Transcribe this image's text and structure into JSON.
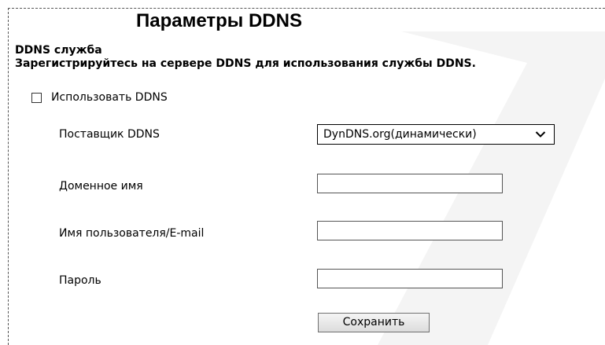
{
  "page": {
    "title": "Параметры DDNS"
  },
  "section": {
    "title": "DDNS служба",
    "description": "Зарегистрируйтесь на сервере DDNS для использования службы DDNS."
  },
  "use_ddns": {
    "label": "Использовать DDNS",
    "checked": false
  },
  "provider": {
    "label": "Поставщик DDNS",
    "selected": "DynDNS.org(динамически)"
  },
  "domain": {
    "label": "Доменное имя",
    "value": ""
  },
  "username": {
    "label": "Имя пользователя/E-mail",
    "value": ""
  },
  "password": {
    "label": "Пароль",
    "value": ""
  },
  "buttons": {
    "save_label": "Сохранить"
  },
  "icons": {
    "select_arrow": "chevron-down-icon",
    "watermark": "watermark-logo-icon"
  },
  "colors": {
    "text": "#000000",
    "frame_border": "#555555",
    "watermark": "#f4f4f4"
  }
}
